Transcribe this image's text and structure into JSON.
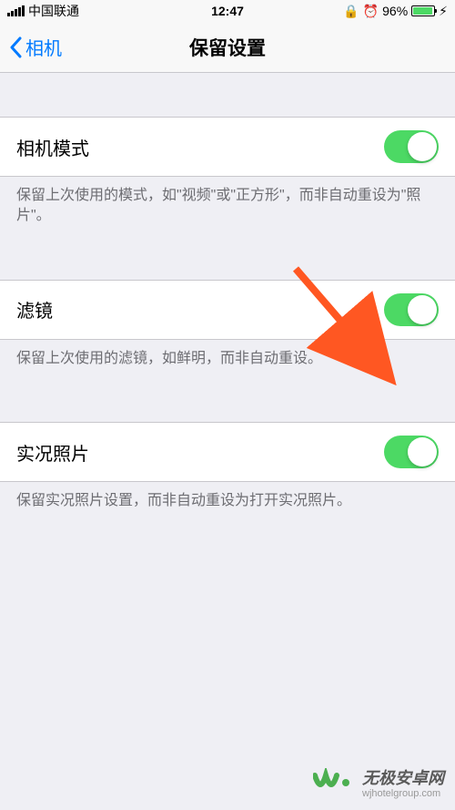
{
  "statusBar": {
    "carrier": "中国联通",
    "time": "12:47",
    "battery": "96%"
  },
  "nav": {
    "back": "相机",
    "title": "保留设置"
  },
  "settings": [
    {
      "label": "相机模式",
      "enabled": true,
      "footer": "保留上次使用的模式，如\"视频\"或\"正方形\"，而非自动重设为\"照片\"。"
    },
    {
      "label": "滤镜",
      "enabled": true,
      "footer": "保留上次使用的滤镜，如鲜明，而非自动重设。"
    },
    {
      "label": "实况照片",
      "enabled": true,
      "footer": "保留实况照片设置，而非自动重设为打开实况照片。"
    }
  ],
  "watermark": {
    "title": "无极安卓网",
    "url": "wjhotelgroup.com"
  }
}
